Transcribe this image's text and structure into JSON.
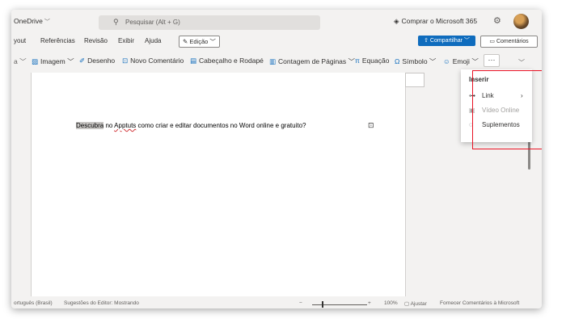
{
  "titlebar": {
    "app_name": "OneDrive",
    "search_placeholder": "Pesquisar (Alt + G)",
    "buy_label": "Comprar o Microsoft 365"
  },
  "menubar": {
    "items": [
      "yout",
      "Referências",
      "Revisão",
      "Exibir",
      "Ajuda"
    ],
    "edit_mode": "Edição",
    "share_label": "Compartilhar",
    "comments_label": "Comentários"
  },
  "ribbon": {
    "items": [
      "Imagem",
      "Desenho",
      "Novo Comentário",
      "Cabeçalho e Rodapé",
      "Contagem de Páginas",
      "Equação",
      "Símbolo",
      "Emoji"
    ],
    "more_label": "···"
  },
  "document": {
    "text_highlight": "Descubra",
    "text_part2": " no ",
    "text_misspelled": "Apptuts",
    "text_part3": " como criar e editar documentos no Word online e gratuito?"
  },
  "dropdown": {
    "header": "Inserir",
    "items": [
      {
        "label": "Link",
        "icon": "link-icon",
        "enabled": true,
        "submenu": true
      },
      {
        "label": "Vídeo Online",
        "icon": "video-icon",
        "enabled": false,
        "submenu": false
      },
      {
        "label": "Suplementos",
        "icon": "addins-icon",
        "enabled": true,
        "submenu": false
      }
    ]
  },
  "statusbar": {
    "language": "ortuguês (Brasil)",
    "editor": "Sugestões do Editor: Mostrando",
    "zoom_minus": "−",
    "zoom_plus": "+",
    "zoom_level": "100%",
    "fit": "Ajustar",
    "feedback": "Fornecer Comentários à Microsoft"
  },
  "colors": {
    "accent": "#0f6cbd",
    "highlight_box": "#e81123"
  }
}
